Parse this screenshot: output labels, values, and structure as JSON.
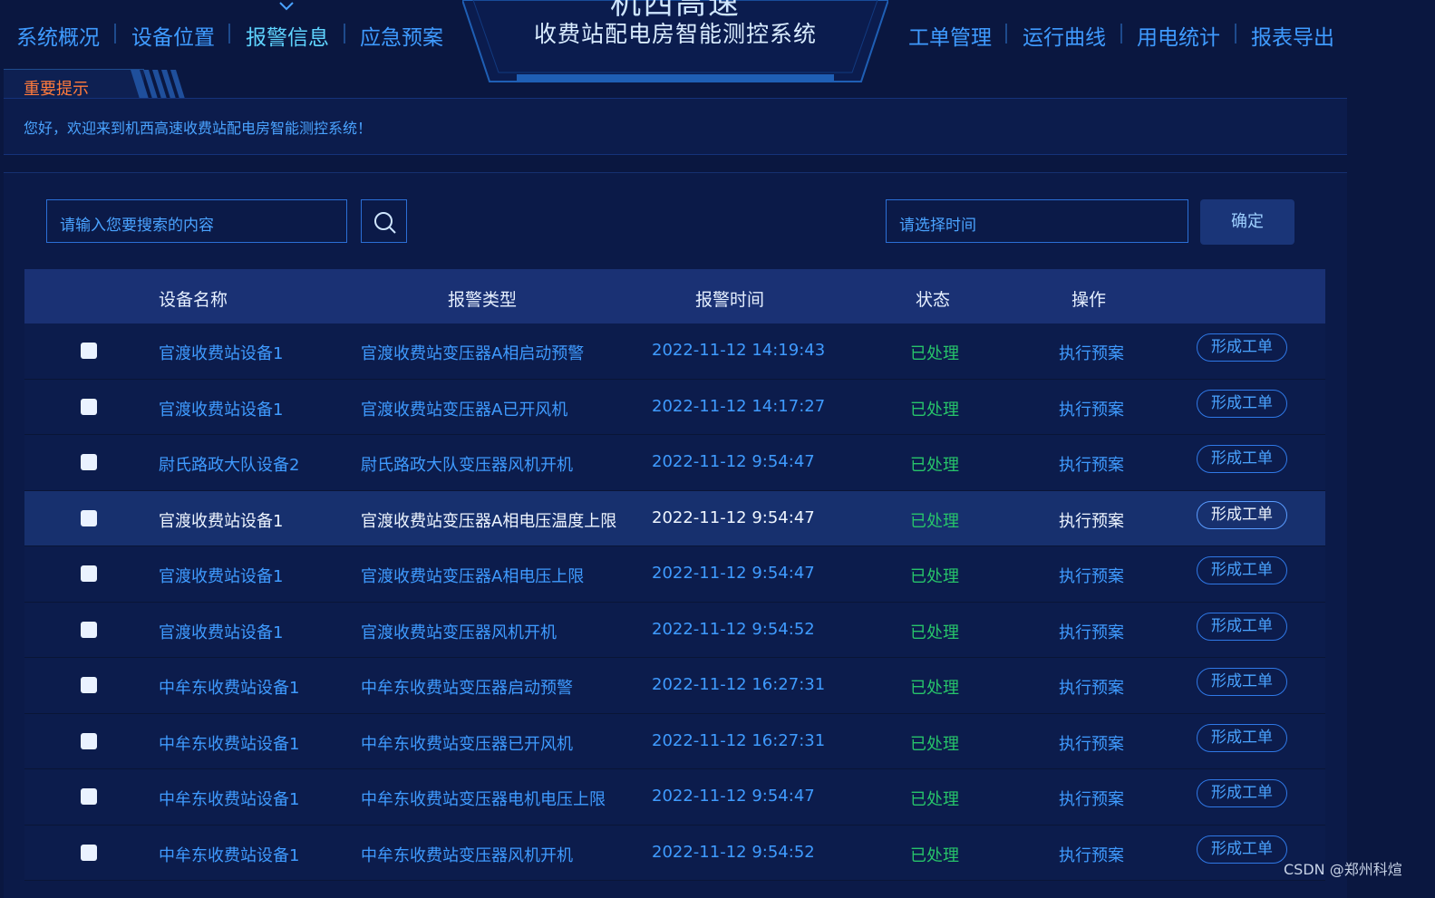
{
  "header": {
    "nav_left": [
      "系统概况",
      "设备位置",
      "报警信息",
      "应急预案"
    ],
    "nav_right": [
      "工单管理",
      "运行曲线",
      "用电统计",
      "报表导出"
    ],
    "active_nav": "报警信息",
    "title_top": "机西高速",
    "title": "收费站配电房智能测控系统"
  },
  "notice": {
    "tab_label": "重要提示",
    "message": "您好，欢迎来到机西高速收费站配电房智能测控系统！"
  },
  "toolbar": {
    "search_placeholder": "请输入您要搜索的内容",
    "time_placeholder": "请选择时间",
    "confirm_label": "确定",
    "search_icon": "search-icon"
  },
  "table": {
    "columns": [
      "设备名称",
      "报警类型",
      "报警时间",
      "状态",
      "操作"
    ],
    "rows": [
      {
        "device": "官渡收费站设备1",
        "type": "官渡收费站变压器A相启动预警",
        "time": "2022-11-12 14:19:43",
        "status": "已处理",
        "action": "执行预案",
        "button": "形成工单"
      },
      {
        "device": "官渡收费站设备1",
        "type": "官渡收费站变压器A已开风机",
        "time": "2022-11-12 14:17:27",
        "status": "已处理",
        "action": "执行预案",
        "button": "形成工单"
      },
      {
        "device": "尉氏路政大队设备2",
        "type": "尉氏路政大队变压器风机开机",
        "time": "2022-11-12 9:54:47",
        "status": "已处理",
        "action": "执行预案",
        "button": "形成工单"
      },
      {
        "device": "官渡收费站设备1",
        "type": "官渡收费站变压器A相电压温度上限",
        "time": "2022-11-12 9:54:47",
        "status": "已处理",
        "action": "执行预案",
        "button": "形成工单"
      },
      {
        "device": "官渡收费站设备1",
        "type": "官渡收费站变压器A相电压上限",
        "time": "2022-11-12 9:54:47",
        "status": "已处理",
        "action": "执行预案",
        "button": "形成工单"
      },
      {
        "device": "官渡收费站设备1",
        "type": "官渡收费站变压器风机开机",
        "time": "2022-11-12 9:54:52",
        "status": "已处理",
        "action": "执行预案",
        "button": "形成工单"
      },
      {
        "device": "中牟东收费站设备1",
        "type": "中牟东收费站变压器启动预警",
        "time": "2022-11-12 16:27:31",
        "status": "已处理",
        "action": "执行预案",
        "button": "形成工单"
      },
      {
        "device": "中牟东收费站设备1",
        "type": "中牟东收费站变压器已开风机",
        "time": "2022-11-12 16:27:31",
        "status": "已处理",
        "action": "执行预案",
        "button": "形成工单"
      },
      {
        "device": "中牟东收费站设备1",
        "type": "中牟东收费站变压器电机电压上限",
        "time": "2022-11-12 9:54:47",
        "status": "已处理",
        "action": "执行预案",
        "button": "形成工单"
      },
      {
        "device": "中牟东收费站设备1",
        "type": "中牟东收费站变压器风机开机",
        "time": "2022-11-12 9:54:52",
        "status": "已处理",
        "action": "执行预案",
        "button": "形成工单"
      }
    ]
  },
  "watermark": "CSDN @郑州科煊",
  "colors": {
    "background": "#0a1740",
    "accent": "#3f9bff",
    "status_ok": "#27c46a",
    "alert_label": "#ff7a3c"
  }
}
